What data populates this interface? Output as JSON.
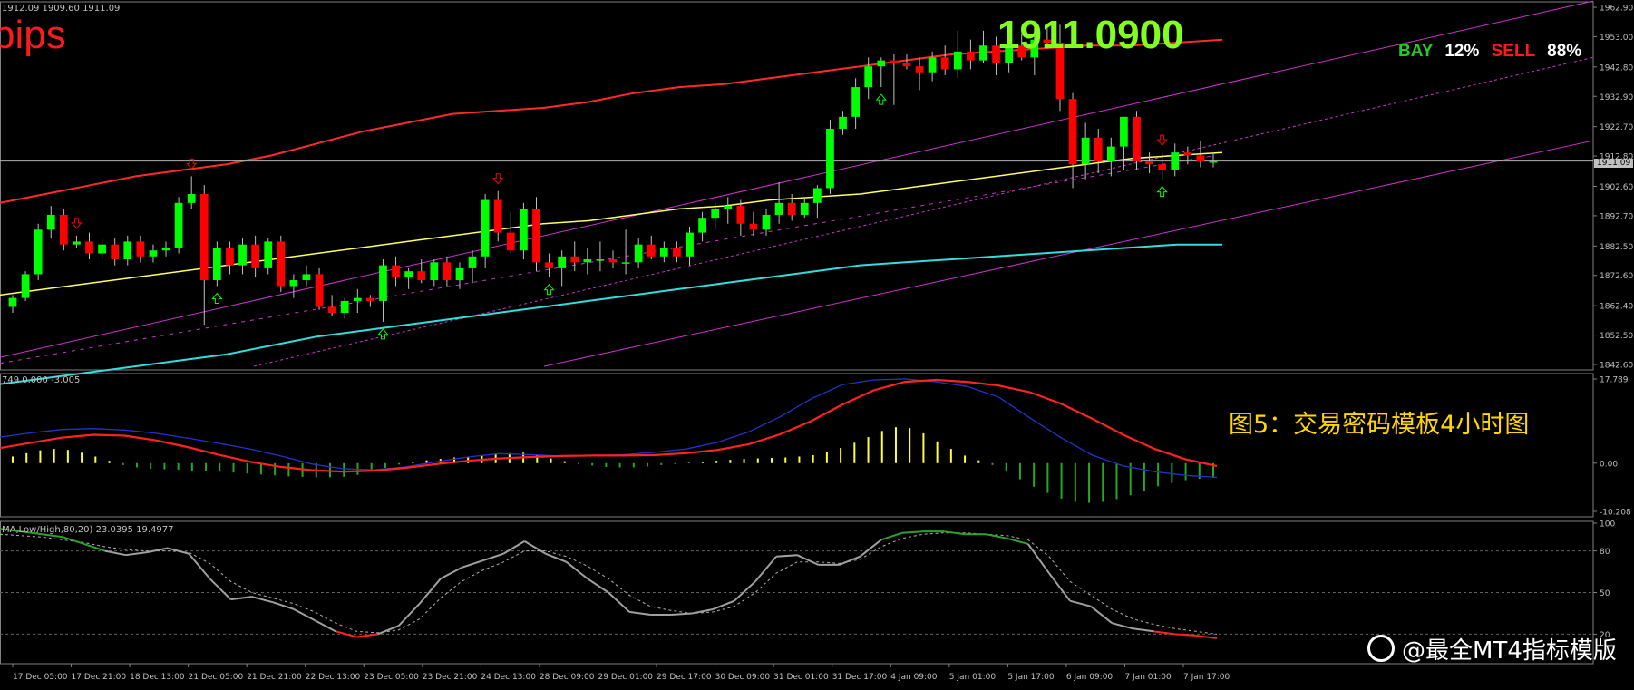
{
  "symbol_line": "1912.09 1909.60 1911.09",
  "pips_label": "pips",
  "big_price": "1911.0900",
  "bay_label": "BAY",
  "bay_pct": "12%",
  "sell_label": "SELL",
  "sell_pct": "88%",
  "current_price_tag": "1911.09",
  "caption": "图5：交易密码模板4小时图",
  "watermark": "@最全MT4指标模版",
  "macd_header": "749 0.000 -3.005",
  "stoch_header": "MA,Low/High,80,20) 23.0395 19.4977",
  "colors": {
    "bg": "#000000",
    "bull": "#00ff00",
    "bear": "#ff0000",
    "ma_mid": "#ffff66",
    "ma_upper": "#ff2a2a",
    "ma_lower": "#33dddd",
    "channel": "#cc33cc",
    "axis_text": "#c0c0c0",
    "price_label_green": "#80ff20",
    "macd_pos": "#ffff33",
    "macd_neg": "#22aa22",
    "macd_signal": "#ff2222",
    "macd_main": "#2233cc",
    "stoch_line": "#a0a0a0",
    "stoch_hot": "#2ea02e",
    "stoch_cold": "#ff2222",
    "caption": "#ffd700"
  },
  "chart_data": [
    {
      "type": "candlestick",
      "title": "",
      "ylim": [
        1842.6,
        1962.9
      ],
      "y_ticks": [
        "1962.90",
        "1953.00",
        "1942.80",
        "1932.90",
        "1922.70",
        "1912.80",
        "1902.60",
        "1892.70",
        "1882.50",
        "1872.60",
        "1862.40",
        "1852.50",
        "1842.60"
      ],
      "current_price": 1911.09,
      "candles": [
        {
          "o": 1862,
          "h": 1866,
          "l": 1860,
          "c": 1865
        },
        {
          "o": 1865,
          "h": 1874,
          "l": 1864,
          "c": 1873
        },
        {
          "o": 1873,
          "h": 1890,
          "l": 1871,
          "c": 1888
        },
        {
          "o": 1888,
          "h": 1896,
          "l": 1885,
          "c": 1893
        },
        {
          "o": 1893,
          "h": 1895,
          "l": 1881,
          "c": 1883
        },
        {
          "o": 1883,
          "h": 1886,
          "l": 1882,
          "c": 1884
        },
        {
          "o": 1884,
          "h": 1887,
          "l": 1878,
          "c": 1880
        },
        {
          "o": 1880,
          "h": 1885,
          "l": 1878,
          "c": 1883
        },
        {
          "o": 1883,
          "h": 1885,
          "l": 1876,
          "c": 1878
        },
        {
          "o": 1878,
          "h": 1886,
          "l": 1876,
          "c": 1884
        },
        {
          "o": 1884,
          "h": 1886,
          "l": 1877,
          "c": 1879
        },
        {
          "o": 1879,
          "h": 1883,
          "l": 1877,
          "c": 1881
        },
        {
          "o": 1881,
          "h": 1884,
          "l": 1879,
          "c": 1882
        },
        {
          "o": 1882,
          "h": 1899,
          "l": 1880,
          "c": 1897
        },
        {
          "o": 1897,
          "h": 1906,
          "l": 1895,
          "c": 1900
        },
        {
          "o": 1900,
          "h": 1903,
          "l": 1856,
          "c": 1871
        },
        {
          "o": 1871,
          "h": 1884,
          "l": 1869,
          "c": 1882
        },
        {
          "o": 1882,
          "h": 1884,
          "l": 1873,
          "c": 1876
        },
        {
          "o": 1876,
          "h": 1885,
          "l": 1873,
          "c": 1883
        },
        {
          "o": 1883,
          "h": 1886,
          "l": 1872,
          "c": 1875
        },
        {
          "o": 1875,
          "h": 1885,
          "l": 1873,
          "c": 1884
        },
        {
          "o": 1884,
          "h": 1886,
          "l": 1867,
          "c": 1869
        },
        {
          "o": 1869,
          "h": 1873,
          "l": 1865,
          "c": 1871
        },
        {
          "o": 1871,
          "h": 1876,
          "l": 1869,
          "c": 1873
        },
        {
          "o": 1873,
          "h": 1875,
          "l": 1861,
          "c": 1862
        },
        {
          "o": 1862,
          "h": 1866,
          "l": 1859,
          "c": 1860
        },
        {
          "o": 1860,
          "h": 1865,
          "l": 1858,
          "c": 1864
        },
        {
          "o": 1864,
          "h": 1868,
          "l": 1860,
          "c": 1865
        },
        {
          "o": 1865,
          "h": 1866,
          "l": 1862,
          "c": 1864
        },
        {
          "o": 1864,
          "h": 1878,
          "l": 1857,
          "c": 1876
        },
        {
          "o": 1876,
          "h": 1879,
          "l": 1869,
          "c": 1872
        },
        {
          "o": 1872,
          "h": 1875,
          "l": 1868,
          "c": 1874
        },
        {
          "o": 1874,
          "h": 1878,
          "l": 1870,
          "c": 1871
        },
        {
          "o": 1871,
          "h": 1878,
          "l": 1869,
          "c": 1877
        },
        {
          "o": 1877,
          "h": 1879,
          "l": 1869,
          "c": 1871
        },
        {
          "o": 1871,
          "h": 1877,
          "l": 1868,
          "c": 1875
        },
        {
          "o": 1875,
          "h": 1881,
          "l": 1870,
          "c": 1879
        },
        {
          "o": 1879,
          "h": 1900,
          "l": 1875,
          "c": 1898
        },
        {
          "o": 1898,
          "h": 1901,
          "l": 1884,
          "c": 1887
        },
        {
          "o": 1887,
          "h": 1894,
          "l": 1880,
          "c": 1881
        },
        {
          "o": 1881,
          "h": 1897,
          "l": 1878,
          "c": 1895
        },
        {
          "o": 1895,
          "h": 1899,
          "l": 1874,
          "c": 1877
        },
        {
          "o": 1877,
          "h": 1880,
          "l": 1872,
          "c": 1875
        },
        {
          "o": 1875,
          "h": 1881,
          "l": 1869,
          "c": 1879
        },
        {
          "o": 1879,
          "h": 1884,
          "l": 1874,
          "c": 1877
        },
        {
          "o": 1877,
          "h": 1882,
          "l": 1873,
          "c": 1878
        },
        {
          "o": 1878,
          "h": 1884,
          "l": 1874,
          "c": 1878
        },
        {
          "o": 1878,
          "h": 1881,
          "l": 1875,
          "c": 1877
        },
        {
          "o": 1877,
          "h": 1888,
          "l": 1873,
          "c": 1877
        },
        {
          "o": 1877,
          "h": 1885,
          "l": 1875,
          "c": 1883
        },
        {
          "o": 1883,
          "h": 1886,
          "l": 1878,
          "c": 1879
        },
        {
          "o": 1879,
          "h": 1884,
          "l": 1877,
          "c": 1882
        },
        {
          "o": 1882,
          "h": 1884,
          "l": 1877,
          "c": 1879
        },
        {
          "o": 1879,
          "h": 1889,
          "l": 1876,
          "c": 1887
        },
        {
          "o": 1887,
          "h": 1894,
          "l": 1884,
          "c": 1892
        },
        {
          "o": 1892,
          "h": 1897,
          "l": 1888,
          "c": 1895
        },
        {
          "o": 1895,
          "h": 1899,
          "l": 1890,
          "c": 1896
        },
        {
          "o": 1896,
          "h": 1898,
          "l": 1886,
          "c": 1890
        },
        {
          "o": 1890,
          "h": 1894,
          "l": 1886,
          "c": 1888
        },
        {
          "o": 1888,
          "h": 1895,
          "l": 1886,
          "c": 1893
        },
        {
          "o": 1893,
          "h": 1904,
          "l": 1890,
          "c": 1897
        },
        {
          "o": 1897,
          "h": 1900,
          "l": 1891,
          "c": 1893
        },
        {
          "o": 1893,
          "h": 1899,
          "l": 1892,
          "c": 1897
        },
        {
          "o": 1897,
          "h": 1903,
          "l": 1892,
          "c": 1902
        },
        {
          "o": 1902,
          "h": 1925,
          "l": 1900,
          "c": 1922
        },
        {
          "o": 1922,
          "h": 1928,
          "l": 1920,
          "c": 1926
        },
        {
          "o": 1926,
          "h": 1939,
          "l": 1922,
          "c": 1936
        },
        {
          "o": 1936,
          "h": 1946,
          "l": 1932,
          "c": 1943
        },
        {
          "o": 1943,
          "h": 1946,
          "l": 1936,
          "c": 1945
        },
        {
          "o": 1945,
          "h": 1947,
          "l": 1930,
          "c": 1944
        },
        {
          "o": 1944,
          "h": 1947,
          "l": 1942,
          "c": 1943
        },
        {
          "o": 1943,
          "h": 1946,
          "l": 1935,
          "c": 1941
        },
        {
          "o": 1941,
          "h": 1948,
          "l": 1938,
          "c": 1946
        },
        {
          "o": 1946,
          "h": 1950,
          "l": 1940,
          "c": 1942
        },
        {
          "o": 1942,
          "h": 1955,
          "l": 1939,
          "c": 1948
        },
        {
          "o": 1948,
          "h": 1952,
          "l": 1942,
          "c": 1945
        },
        {
          "o": 1945,
          "h": 1955,
          "l": 1944,
          "c": 1950
        },
        {
          "o": 1950,
          "h": 1953,
          "l": 1940,
          "c": 1944
        },
        {
          "o": 1944,
          "h": 1955,
          "l": 1941,
          "c": 1950
        },
        {
          "o": 1950,
          "h": 1954,
          "l": 1945,
          "c": 1946
        },
        {
          "o": 1946,
          "h": 1956,
          "l": 1940,
          "c": 1952
        },
        {
          "o": 1952,
          "h": 1957,
          "l": 1949,
          "c": 1951
        },
        {
          "o": 1951,
          "h": 1957,
          "l": 1928,
          "c": 1932
        },
        {
          "o": 1932,
          "h": 1934,
          "l": 1902,
          "c": 1910
        },
        {
          "o": 1910,
          "h": 1924,
          "l": 1905,
          "c": 1919
        },
        {
          "o": 1919,
          "h": 1922,
          "l": 1907,
          "c": 1911
        },
        {
          "o": 1911,
          "h": 1919,
          "l": 1906,
          "c": 1916
        },
        {
          "o": 1916,
          "h": 1926,
          "l": 1908,
          "c": 1926
        },
        {
          "o": 1926,
          "h": 1928,
          "l": 1908,
          "c": 1911
        },
        {
          "o": 1911,
          "h": 1914,
          "l": 1907,
          "c": 1910
        },
        {
          "o": 1910,
          "h": 1914,
          "l": 1905,
          "c": 1908
        },
        {
          "o": 1908,
          "h": 1917,
          "l": 1906,
          "c": 1914
        },
        {
          "o": 1914,
          "h": 1916,
          "l": 1910,
          "c": 1913
        },
        {
          "o": 1913,
          "h": 1918,
          "l": 1909,
          "c": 1911
        },
        {
          "o": 1911,
          "h": 1914,
          "l": 1909,
          "c": 1911
        }
      ],
      "ma_mid": [
        1866,
        1868,
        1870,
        1872,
        1874,
        1876,
        1878,
        1880,
        1882,
        1884,
        1886,
        1888,
        1890,
        1891,
        1893,
        1895,
        1896,
        1898,
        1899,
        1900,
        1902,
        1904,
        1906,
        1908,
        1910,
        1912,
        1913,
        1914
      ],
      "ma_upper": [
        1897,
        1900,
        1903,
        1906,
        1908,
        1910,
        1913,
        1917,
        1921,
        1924,
        1927,
        1928,
        1929,
        1931,
        1934,
        1936,
        1937,
        1939,
        1941,
        1943,
        1945,
        1947,
        1948,
        1949,
        1950,
        1950,
        1951,
        1952
      ],
      "ma_lower": [
        1836,
        1838,
        1840,
        1842,
        1844,
        1846,
        1849,
        1852,
        1854,
        1856,
        1858,
        1860,
        1862,
        1864,
        1866,
        1868,
        1870,
        1872,
        1874,
        1876,
        1877,
        1878,
        1879,
        1880,
        1881,
        1882,
        1883,
        1883
      ]
    },
    {
      "type": "bar",
      "title": "",
      "ylim": [
        -10.208,
        17.789
      ],
      "y_ticks": [
        "17.789",
        "0.00",
        "-10.208"
      ],
      "histogram": [
        1.4,
        2.1,
        2.7,
        3.0,
        2.8,
        2.2,
        1.4,
        0.5,
        -0.4,
        -0.9,
        -1.2,
        -1.3,
        -1.4,
        -1.6,
        -1.7,
        -1.8,
        -2.0,
        -2.2,
        -2.4,
        -2.6,
        -2.8,
        -2.9,
        -3.0,
        -3.0,
        -2.9,
        -2.5,
        -1.8,
        -1.0,
        -0.3,
        0.3,
        0.6,
        0.9,
        1.2,
        1.4,
        1.6,
        1.9,
        2.1,
        2.2,
        1.7,
        1.0,
        0.4,
        -0.2,
        -0.5,
        -0.8,
        -0.9,
        -0.9,
        -0.7,
        -0.4,
        -0.2,
        0.1,
        0.3,
        0.5,
        0.7,
        0.9,
        1.0,
        1.1,
        1.2,
        1.4,
        1.7,
        2.3,
        3.2,
        4.3,
        5.5,
        6.8,
        7.6,
        7.4,
        6.3,
        4.6,
        3.0,
        1.6,
        0.6,
        -0.4,
        -1.8,
        -3.4,
        -5.0,
        -6.3,
        -7.5,
        -8.2,
        -8.4,
        -8.2,
        -7.6,
        -6.8,
        -5.8,
        -4.9,
        -4.2,
        -3.6,
        -3.3,
        -3.1
      ],
      "signal": [
        3.2,
        4.3,
        5.4,
        6.0,
        5.8,
        4.8,
        3.4,
        1.8,
        0.3,
        -0.8,
        -1.5,
        -1.8,
        -1.6,
        -1.0,
        -0.2,
        0.5,
        1.0,
        1.3,
        1.5,
        1.6,
        1.6,
        1.7,
        2.1,
        2.8,
        4.0,
        6.1,
        8.9,
        12.4,
        15.4,
        17.2,
        17.6,
        17.2,
        16.4,
        15.0,
        12.6,
        9.4,
        6.0,
        3.0,
        0.8,
        -0.6
      ],
      "main": [
        5.5,
        6.4,
        7.1,
        7.3,
        7.0,
        6.3,
        5.3,
        4.2,
        3.0,
        1.5,
        -0.2,
        -1.2,
        -1.4,
        -0.8,
        0.3,
        1.3,
        2.0,
        1.8,
        1.5,
        1.6,
        1.8,
        2.3,
        3.0,
        4.4,
        6.6,
        9.8,
        13.6,
        16.6,
        17.6,
        17.8,
        17.2,
        16.2,
        14.0,
        9.6,
        5.4,
        1.7,
        -0.6,
        -1.8,
        -2.6,
        -3.0
      ]
    },
    {
      "type": "line",
      "title": "",
      "ylim": [
        0,
        100
      ],
      "y_ticks": [
        "100",
        "80",
        "50",
        "20"
      ],
      "levels": [
        80,
        50,
        20
      ],
      "main": [
        96,
        94,
        92,
        90,
        85,
        80,
        77,
        79,
        82,
        78,
        60,
        45,
        47,
        43,
        38,
        30,
        22,
        18,
        20,
        26,
        42,
        60,
        68,
        73,
        78,
        87,
        78,
        72,
        60,
        50,
        36,
        34,
        34,
        35,
        38,
        44,
        58,
        76,
        77,
        70,
        70,
        76,
        88,
        93,
        94,
        94,
        92,
        92,
        89,
        85,
        64,
        44,
        40,
        28,
        24,
        22,
        20,
        19,
        17
      ],
      "signal": [
        92,
        91,
        90,
        88,
        86,
        83,
        81,
        80,
        80,
        79,
        71,
        58,
        50,
        46,
        42,
        36,
        28,
        22,
        21,
        23,
        31,
        46,
        58,
        66,
        72,
        80,
        80,
        76,
        69,
        60,
        48,
        40,
        37,
        35,
        36,
        40,
        50,
        64,
        72,
        72,
        71,
        74,
        83,
        89,
        92,
        93,
        93,
        92,
        91,
        88,
        76,
        58,
        48,
        38,
        31,
        27,
        24,
        22,
        20
      ]
    }
  ],
  "x_ticks": [
    "17 Dec 05:00",
    "17 Dec 21:00",
    "18 Dec 13:00",
    "21 Dec 05:00",
    "21 Dec 21:00",
    "22 Dec 13:00",
    "23 Dec 05:00",
    "23 Dec 21:00",
    "24 Dec 13:00",
    "28 Dec 09:00",
    "29 Dec 01:00",
    "29 Dec 17:00",
    "30 Dec 09:00",
    "31 Dec 01:00",
    "31 Dec 17:00",
    "4 Jan 09:00",
    "5 Jan 01:00",
    "5 Jan 17:00",
    "6 Jan 09:00",
    "7 Jan 01:00",
    "7 Jan 17:00"
  ],
  "signals": {
    "up_arrows": [
      16,
      29,
      42,
      68,
      90
    ],
    "down_arrows": [
      5,
      14,
      38,
      90
    ]
  }
}
